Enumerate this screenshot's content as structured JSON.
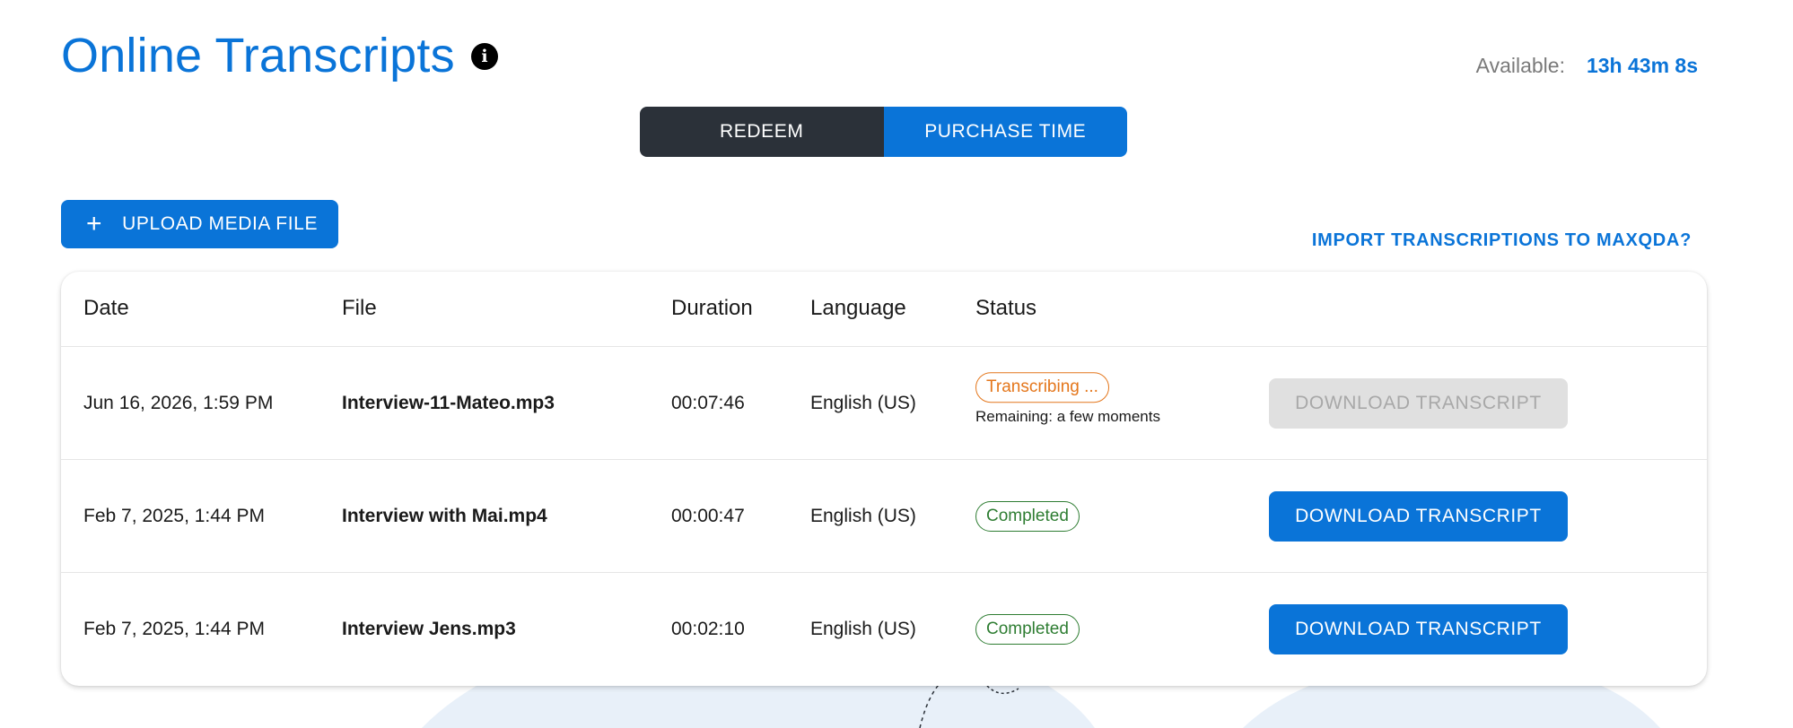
{
  "header": {
    "title": "Online Transcripts",
    "available_label": "Available:",
    "available_value": "13h 43m 8s"
  },
  "segment": {
    "redeem_label": "REDEEM",
    "purchase_label": "PURCHASE TIME"
  },
  "actions": {
    "upload_label": "UPLOAD MEDIA FILE",
    "import_link": "IMPORT TRANSCRIPTIONS TO MAXQDA?"
  },
  "table": {
    "columns": {
      "date": "Date",
      "file": "File",
      "duration": "Duration",
      "language": "Language",
      "status": "Status"
    },
    "rows": [
      {
        "date": "Jun 16, 2026, 1:59 PM",
        "file": "Interview-11-Mateo.mp3",
        "duration": "00:07:46",
        "language": "English (US)",
        "status": "Transcribing ...",
        "status_sub": "Remaining: a few moments",
        "action": "DOWNLOAD TRANSCRIPT"
      },
      {
        "date": "Feb 7, 2025, 1:44 PM",
        "file": "Interview with Mai.mp4",
        "duration": "00:00:47",
        "language": "English (US)",
        "status": "Completed",
        "action": "DOWNLOAD TRANSCRIPT"
      },
      {
        "date": "Feb 7, 2025, 1:44 PM",
        "file": "Interview Jens.mp3",
        "duration": "00:02:10",
        "language": "English (US)",
        "status": "Completed",
        "action": "DOWNLOAD TRANSCRIPT"
      }
    ]
  },
  "colors": {
    "accent": "#0a74d8",
    "dark": "#2b3139",
    "transcribing": "#e4761b",
    "completed": "#2e7d32",
    "background_deco": "#e8f0f9"
  },
  "icons": {
    "info": "info-icon",
    "plus": "plus-icon"
  }
}
